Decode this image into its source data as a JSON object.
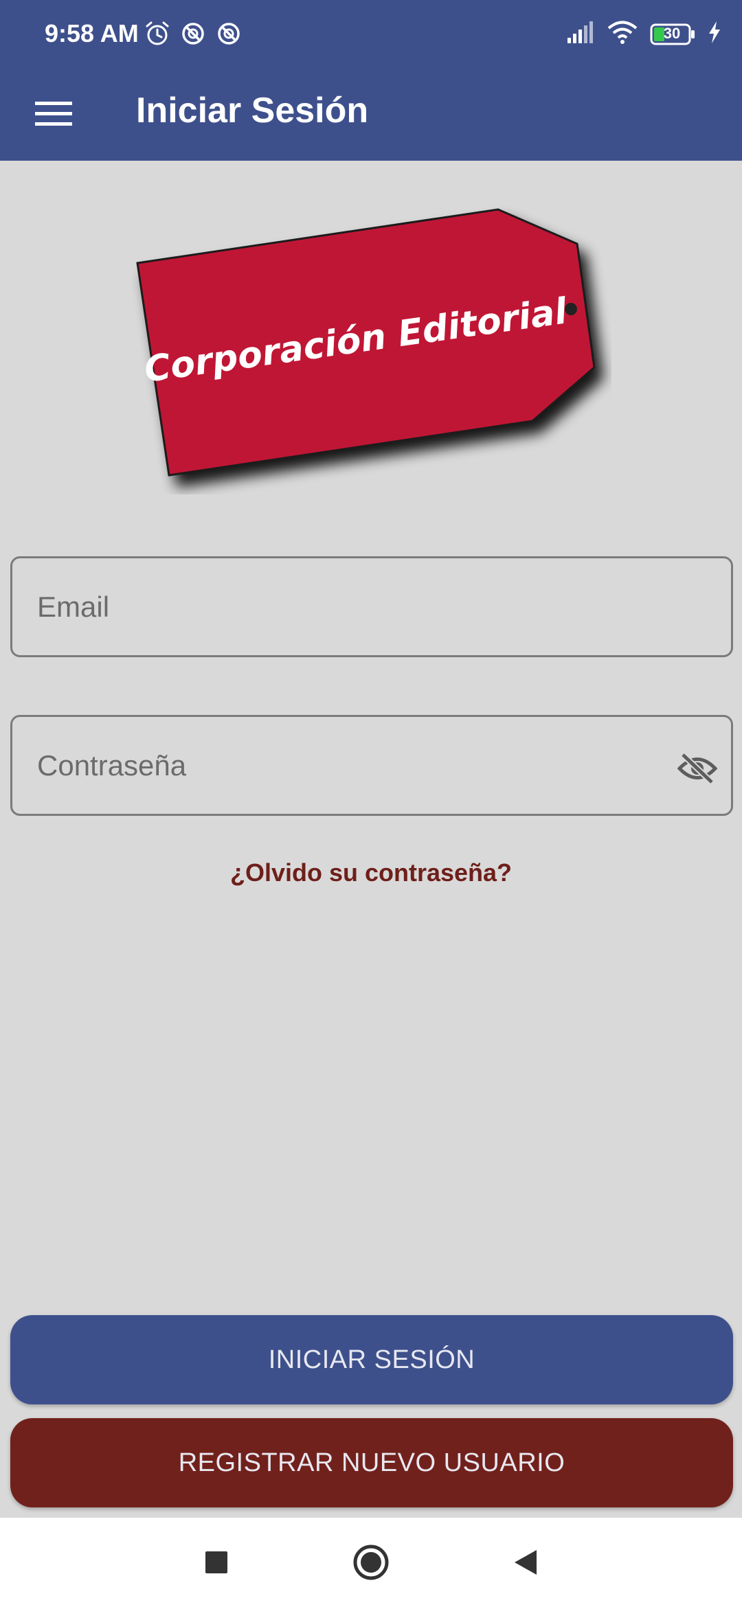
{
  "status_bar": {
    "time": "9:58 AM",
    "battery": "30",
    "icons": [
      "alarm-icon",
      "data-saver-icon",
      "data-saver-icon",
      "signal-icon",
      "wifi-icon",
      "battery-icon",
      "charging-icon"
    ]
  },
  "app_bar": {
    "title": "Iniciar Sesión",
    "menu_icon": "hamburger-menu-icon"
  },
  "logo": {
    "text": "Corporación Editorial",
    "color": "#c01236"
  },
  "form": {
    "email_placeholder": "Email",
    "password_placeholder": "Contraseña",
    "password_toggle_icon": "eye-off-icon",
    "forgot_link": "¿Olvido su contraseña?"
  },
  "buttons": {
    "login_label": "INICIAR SESIÓN",
    "register_label": "REGISTRAR NUEVO USUARIO"
  },
  "nav": {
    "items": [
      "recents-icon",
      "home-icon",
      "back-icon"
    ]
  },
  "colors": {
    "primary": "#3e508c",
    "secondary": "#71211c",
    "background": "#d9d9d9",
    "link": "#6e1f1a"
  }
}
